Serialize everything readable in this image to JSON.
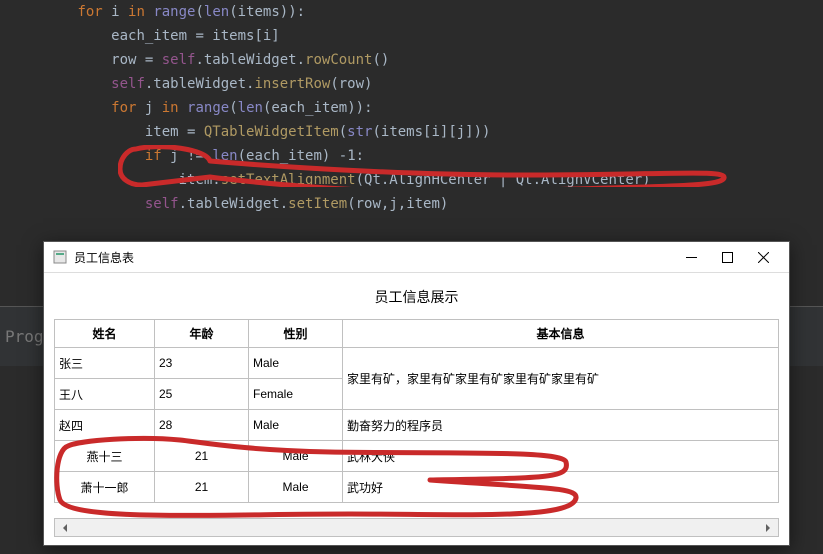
{
  "progress_label": "Progr",
  "code": {
    "lines": [
      [
        [
          "kw-orange",
          "for"
        ],
        [
          "",
          " i "
        ],
        [
          "kw-orange",
          "in"
        ],
        [
          "",
          " "
        ],
        [
          "builtin",
          "range"
        ],
        [
          "",
          "("
        ],
        [
          "builtin",
          "len"
        ],
        [
          "",
          "(items)):"
        ]
      ],
      [
        [
          "",
          "    each_item = items[i]"
        ]
      ],
      [
        [
          "",
          "    row = "
        ],
        [
          "self",
          "self"
        ],
        [
          "",
          ".tableWidget."
        ],
        [
          "fn-call",
          "rowCount"
        ],
        [
          "",
          "()"
        ]
      ],
      [
        [
          "",
          "    "
        ],
        [
          "self",
          "self"
        ],
        [
          "",
          ".tableWidget."
        ],
        [
          "fn-call",
          "insertRow"
        ],
        [
          "",
          "(row)"
        ]
      ],
      [
        [
          "",
          "    "
        ],
        [
          "kw-orange",
          "for"
        ],
        [
          "",
          " j "
        ],
        [
          "kw-orange",
          "in"
        ],
        [
          "",
          " "
        ],
        [
          "builtin",
          "range"
        ],
        [
          "",
          "("
        ],
        [
          "builtin",
          "len"
        ],
        [
          "",
          "(each_item)):"
        ]
      ],
      [
        [
          "",
          "        item = "
        ],
        [
          "fn-call",
          "QTableWidgetItem"
        ],
        [
          "",
          "("
        ],
        [
          "builtin",
          "str"
        ],
        [
          "",
          "(items[i][j]))"
        ]
      ],
      [
        [
          "",
          "        "
        ],
        [
          "kw-orange",
          "if"
        ],
        [
          "",
          " j != "
        ],
        [
          "builtin",
          "len"
        ],
        [
          "",
          "(each_item) -"
        ],
        [
          "",
          "1"
        ],
        [
          "",
          ":"
        ]
      ],
      [
        [
          "",
          "            item."
        ],
        [
          "fn-call",
          "setTextAlignment"
        ],
        [
          "",
          "(Qt.AlignHCenter | Qt.AlignVCenter)"
        ]
      ],
      [
        [
          "",
          "        "
        ],
        [
          "self",
          "self"
        ],
        [
          "",
          ".tableWidget."
        ],
        [
          "fn-call",
          "setItem"
        ],
        [
          "",
          "(row,j,item)"
        ]
      ]
    ],
    "indent": "        "
  },
  "window": {
    "title": "员工信息表",
    "heading": "员工信息展示",
    "columns": [
      "姓名",
      "年龄",
      "性别",
      "基本信息"
    ],
    "rows": [
      {
        "name": "张三",
        "age": "23",
        "gender": "Male",
        "info": "家里有矿，家里有矿家里有矿家里有矿家里有矿",
        "centered": false,
        "info_rowspan": 2
      },
      {
        "name": "王八",
        "age": "25",
        "gender": "Female",
        "info": null,
        "centered": false
      },
      {
        "name": "赵四",
        "age": "28",
        "gender": "Male",
        "info": "勤奋努力的程序员",
        "centered": false
      },
      {
        "name": "燕十三",
        "age": "21",
        "gender": "Male",
        "info": "武林大侠",
        "centered": true
      },
      {
        "name": "萧十一郎",
        "age": "21",
        "gender": "Male",
        "info": "武功好",
        "centered": true
      }
    ]
  }
}
